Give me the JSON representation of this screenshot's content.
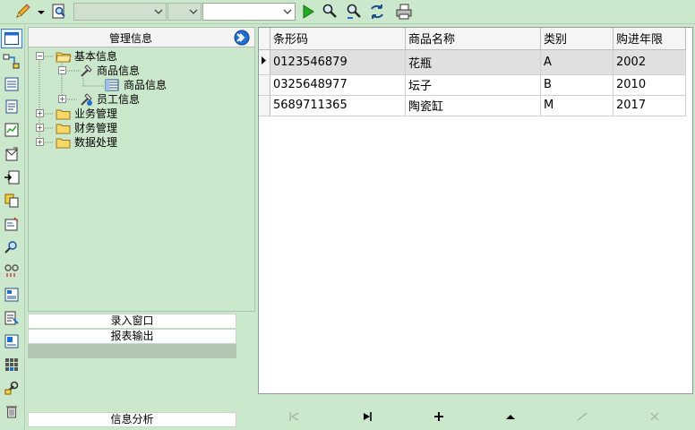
{
  "toolbar": {
    "icons": [
      "pencil-icon",
      "dropdown-arrow-icon",
      "document-search-icon",
      "run-icon",
      "find-icon",
      "find-next-icon",
      "refresh-icon",
      "print-icon"
    ],
    "combo1_value": "",
    "combo2_value": "",
    "search_value": ""
  },
  "sidebar": {
    "icons": [
      "window-icon",
      "relation-icon",
      "list-icon",
      "document-icon",
      "chart-icon",
      "envelope-icon",
      "export-icon",
      "copy-icon",
      "properties-icon",
      "user-search-icon",
      "link-icon",
      "report-icon",
      "form-icon",
      "report-template-icon",
      "grid-icon",
      "tools-icon",
      "trash-icon"
    ]
  },
  "nav": {
    "title": "管理信息",
    "tree": {
      "basic_info": "基本信息",
      "goods_info": "商品信息",
      "goods_info_leaf": "商品信息",
      "staff_info": "员工信息",
      "business": "业务管理",
      "finance": "财务管理",
      "data_processing": "数据处理"
    }
  },
  "sections": {
    "entry_window": "录入窗口",
    "report_output": "报表输出",
    "info_analysis": "信息分析"
  },
  "grid": {
    "columns": [
      "条形码",
      "商品名称",
      "类别",
      "购进年限"
    ],
    "rows": [
      {
        "barcode": "0123546879",
        "name": "花瓶",
        "category": "A",
        "year": "2002"
      },
      {
        "barcode": "0325648977",
        "name": "坛子",
        "category": "B",
        "year": "2010"
      },
      {
        "barcode": "5689711365",
        "name": "陶瓷缸",
        "category": "M",
        "year": "2017"
      }
    ]
  },
  "navigator": {
    "buttons": [
      "first-record-icon",
      "last-record-icon",
      "add-record-icon",
      "prior-record-icon",
      "post-icon",
      "cancel-icon"
    ]
  },
  "colors": {
    "background": "#cce8cc",
    "selected_row": "#e0e0e0",
    "accent_blue": "#1f6fd0",
    "run_green": "#22aa22"
  }
}
